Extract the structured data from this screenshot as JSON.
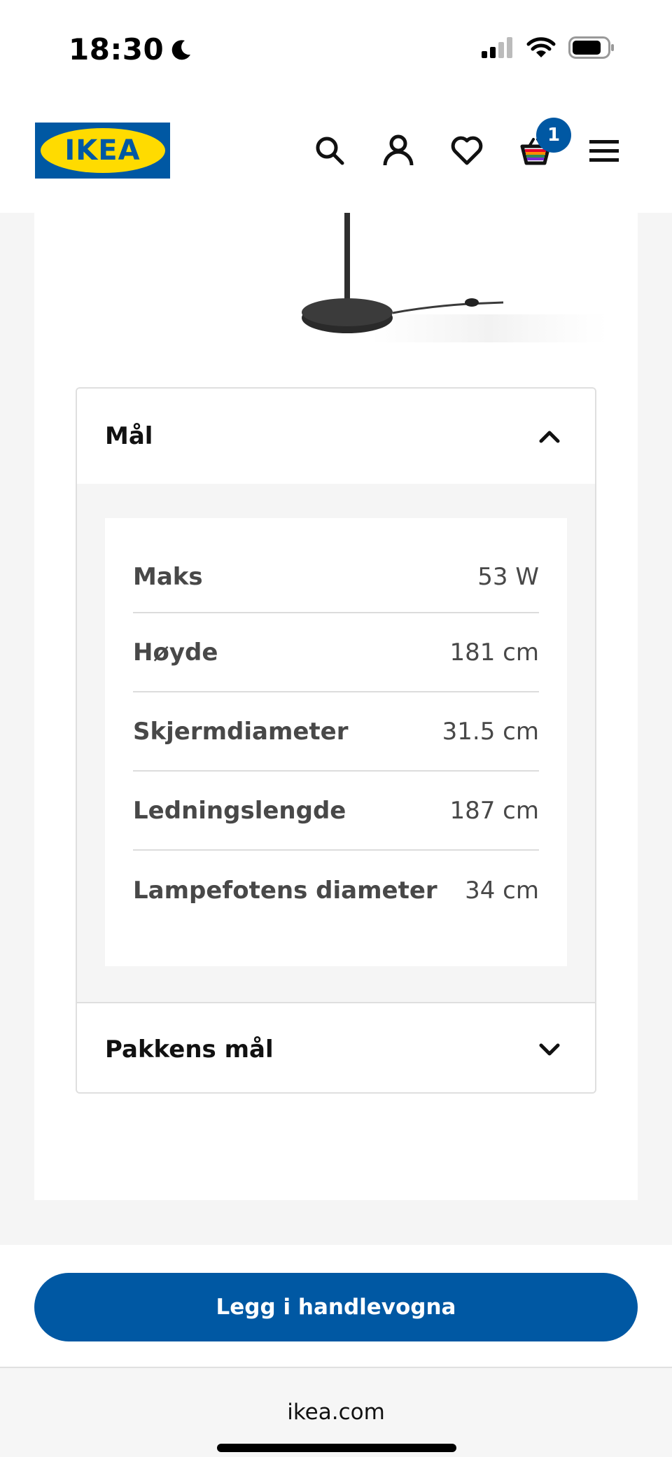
{
  "status": {
    "time": "18:30",
    "icons": [
      "moon-icon",
      "signal-icon",
      "wifi-icon",
      "battery-icon"
    ]
  },
  "header": {
    "logo_text": "IKEA",
    "icons": [
      "search-icon",
      "account-icon",
      "heart-icon",
      "cart-icon",
      "menu-icon"
    ],
    "cart_count": "1"
  },
  "product": {
    "image": "floor-lamp-base-image"
  },
  "dimensions": {
    "title": "Mål",
    "expanded": true,
    "rows": [
      {
        "label": "Maks",
        "value": "53 W"
      },
      {
        "label": "Høyde",
        "value": "181 cm"
      },
      {
        "label": "Skjermdiameter",
        "value": "31.5 cm"
      },
      {
        "label": "Ledningslengde",
        "value": "187 cm"
      },
      {
        "label": "Lampefotens diameter",
        "value": "34 cm"
      }
    ]
  },
  "package": {
    "title": "Pakkens mål",
    "expanded": false
  },
  "cta": {
    "label": "Legg i handlevogna"
  },
  "browser": {
    "url": "ikea.com"
  },
  "colors": {
    "brand_blue": "#0058a3",
    "brand_yellow": "#ffdb00"
  }
}
